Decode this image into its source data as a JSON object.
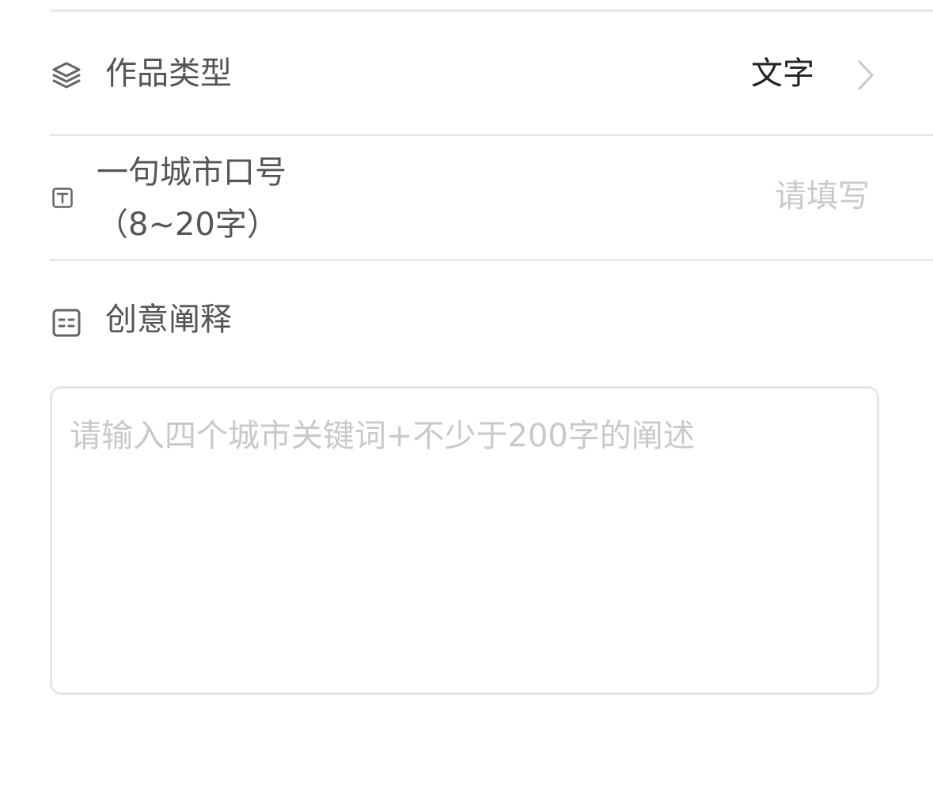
{
  "form": {
    "work_type": {
      "icon": "layers-icon",
      "label": "作品类型",
      "value": "文字"
    },
    "slogan": {
      "icon": "text-box-icon",
      "label_line1": "一句城市口号",
      "label_line2": "（8~20字）",
      "placeholder": "请填写"
    },
    "explanation": {
      "icon": "document-icon",
      "label": "创意阐释",
      "placeholder": "请输入四个城市关键词+不少于200字的阐述"
    }
  },
  "colors": {
    "label": "#555555",
    "value": "#222222",
    "placeholder": "#c9c9c9",
    "divider": "#e8e8e8"
  }
}
